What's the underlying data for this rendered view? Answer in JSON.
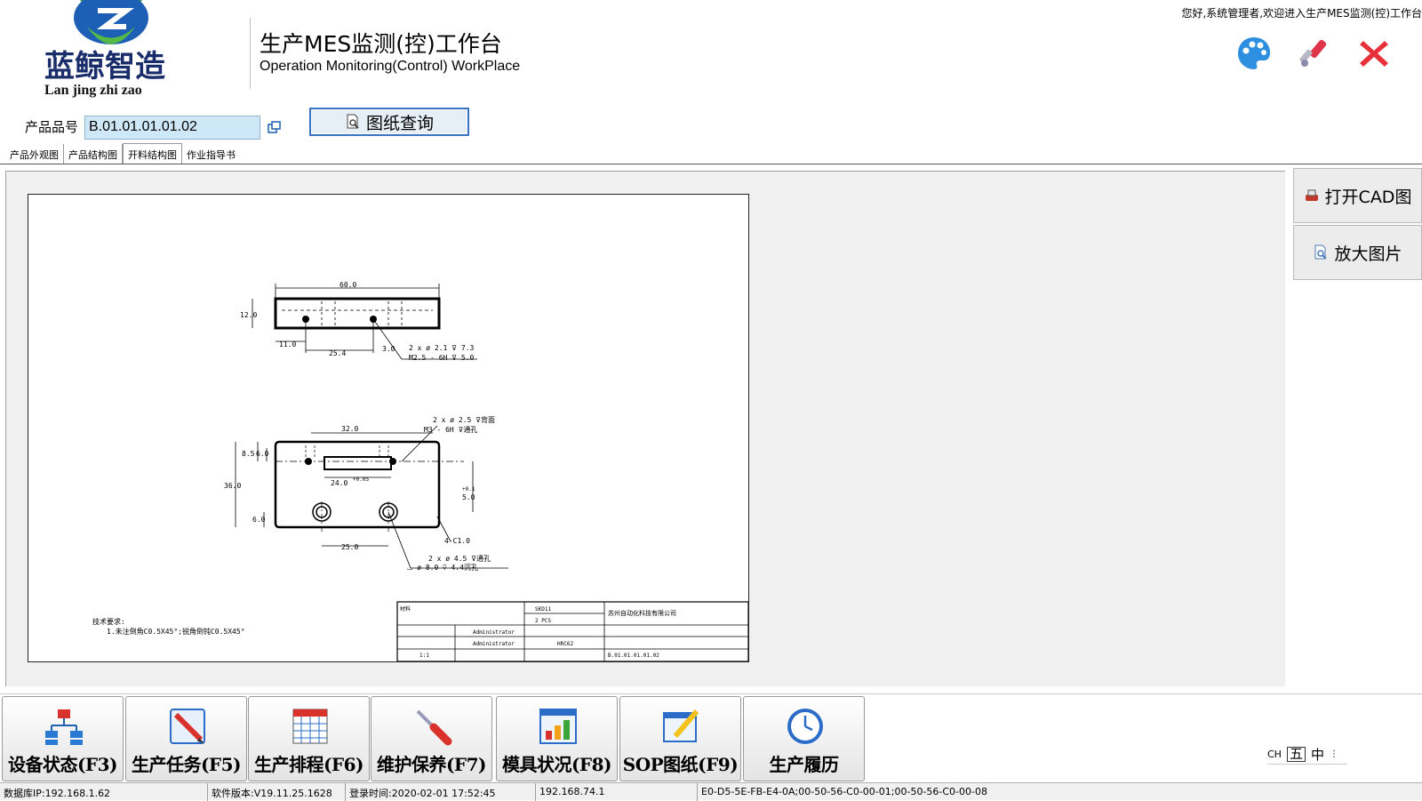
{
  "header": {
    "logo_text_cn": "蓝鲸智造",
    "logo_text_en": "Lan jing zhi zao",
    "title_cn": "生产MES监测(控)工作台",
    "title_en": "Operation Monitoring(Control) WorkPlace",
    "welcome": "您好,系统管理者,欢迎进入生产MES监测(控)工作台",
    "icons": [
      "palette-icon",
      "wrench-icon",
      "close-icon"
    ]
  },
  "product": {
    "label": "产品品号",
    "value": "B.01.01.01.01.02",
    "query_button": "图纸查询"
  },
  "tabs": [
    {
      "label": "产品外观图",
      "active": false
    },
    {
      "label": "产品结构图",
      "active": false
    },
    {
      "label": "开料结构图",
      "active": true
    },
    {
      "label": "作业指导书",
      "active": false
    }
  ],
  "side_buttons": {
    "open_cad": "打开CAD图",
    "zoom_image": "放大图片"
  },
  "drawing": {
    "dims": {
      "top_width": "60.0",
      "top_height": "12.0",
      "top_left_offset": "11.0",
      "top_hole_spacing": "25.4",
      "top_depth": "3.0",
      "top_callout_1": "2 x ø  2.1 ⊽ 7.3",
      "top_callout_2": "M2.5 - 6H ⊽ 5.0",
      "front_width": "32.0",
      "front_h1": "8.5",
      "front_h2": "6.0",
      "front_total": "36.0",
      "front_bottom": "6.0",
      "slot_width": "24.0",
      "slot_tol": "+0.05",
      "right_dim": "5.0",
      "right_tol": "+0.1",
      "hole_spacing": "25.0",
      "chamfer": "4-C1.0",
      "callout_top_1": "2 x ø  2.5 ⊽背面",
      "callout_top_2": "M3 - 6H ⊽通孔",
      "callout_bot_1": "2 x ø  4.5 ⊽通孔",
      "callout_bot_2": "⌴ ø  8.0 ⊽ 4.4沉孔",
      "note_title": "技术要求:",
      "note_body": "1.未注倒角C0.5X45°;锐角倒钝C0.5X45°",
      "tb_material": "材料",
      "tb_material_val": "SKD11",
      "tb_qty_val": "2 PCS",
      "tb_company": "苏州自动化科技有限公司",
      "tb_user1": "Administrator",
      "tb_user2": "Administrator",
      "tb_hardness": "HRC62",
      "tb_scale": "1:1",
      "tb_partno": "B.01.01.01.01.02"
    }
  },
  "toolbar": [
    {
      "label": "设备状态(F3)",
      "icon": "network-icon"
    },
    {
      "label": "生产任务(F5)",
      "icon": "task-edit-icon"
    },
    {
      "label": "生产排程(F6)",
      "icon": "calendar-icon"
    },
    {
      "label": "维护保养(F7)",
      "icon": "screwdriver-icon"
    },
    {
      "label": "模具状况(F8)",
      "icon": "bar-chart-icon"
    },
    {
      "label": "SOP图纸(F9)",
      "icon": "pencil-window-icon"
    },
    {
      "label": "生产履历",
      "icon": "clock-icon"
    }
  ],
  "ime": {
    "lang": "CH",
    "mode1": "五",
    "mode2": "中"
  },
  "status": {
    "db_ip": "数据库IP:192.168.1.62",
    "version": "软件版本:V19.11.25.1628",
    "login_time": "登录时间:2020-02-01 17:52:45",
    "local_ip": "192.168.74.1",
    "mac": "E0-D5-5E-FB-E4-0A;00-50-56-C0-00-01;00-50-56-C0-00-08"
  },
  "colors": {
    "accent_blue": "#3a72c4",
    "logo_green": "#3aa63a",
    "logo_blue": "#1b5fb3",
    "input_bg": "#cfe8f7"
  }
}
